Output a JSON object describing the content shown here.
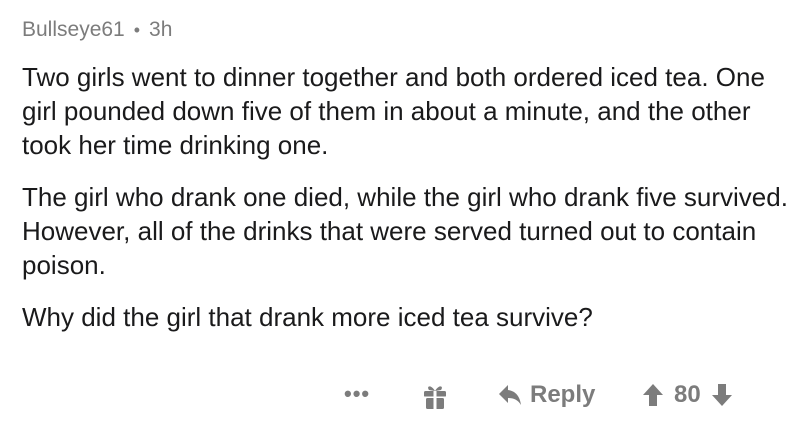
{
  "comment": {
    "author": "Bullseye61",
    "separator": "•",
    "age": "3h",
    "paragraphs": [
      "Two girls went to dinner together and both ordered iced tea. One girl pounded down five of them in about a minute, and the other took her time drinking one.",
      "The girl who drank one died, while the girl who drank five survived. However, all of the drinks that were served turned out to contain poison.",
      "Why did the girl that drank more iced tea survive?"
    ]
  },
  "actions": {
    "more_label": "•••",
    "award_icon": "gift-icon",
    "reply_icon": "reply-arrow-icon",
    "reply_label": "Reply",
    "upvote_icon": "upvote-arrow-icon",
    "score": "80",
    "downvote_icon": "downvote-arrow-icon"
  },
  "colors": {
    "text": "#1a1a1b",
    "muted": "#7c7c7c",
    "background": "#ffffff"
  }
}
